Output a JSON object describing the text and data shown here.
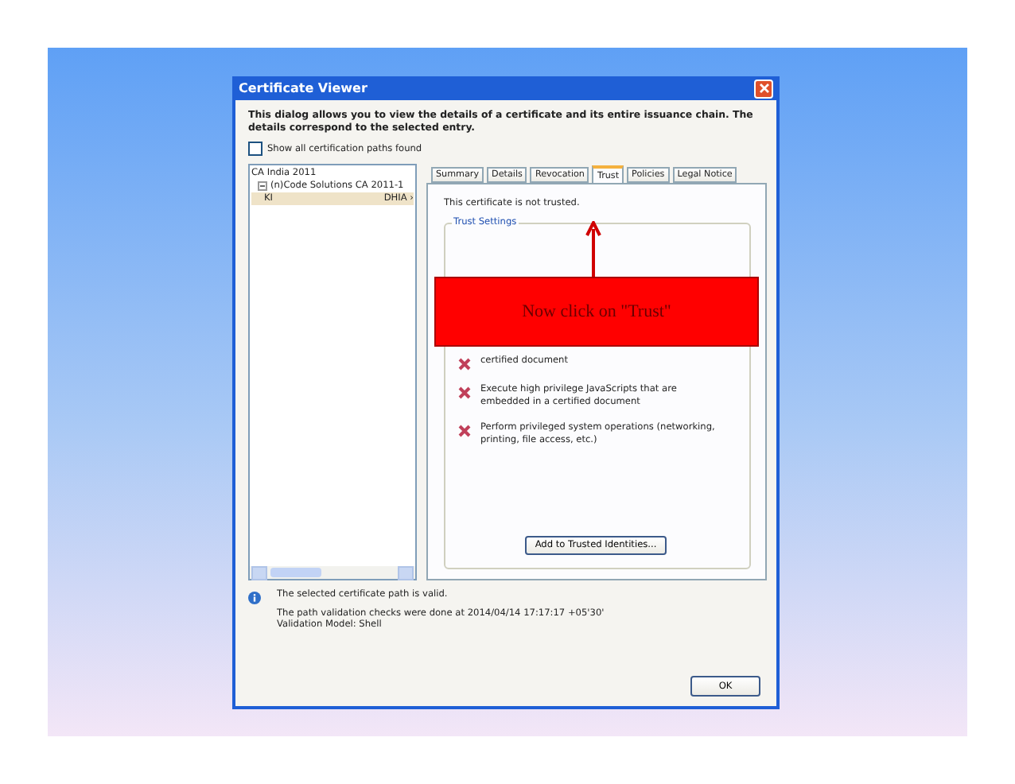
{
  "window": {
    "title": "Certificate Viewer"
  },
  "description": "This dialog allows you to view the details of a certificate and its entire issuance chain. The details correspond to the selected entry.",
  "show_all_paths": {
    "label": "Show all certification paths found",
    "checked": false
  },
  "tree": [
    {
      "label": "CA India 2011",
      "selected": false,
      "children": [
        {
          "label": "(n)Code Solutions CA 2011-1",
          "expanded": true,
          "selected": false,
          "children": [
            {
              "label": "KI",
              "column_2": "DHIA ›",
              "selected": true
            }
          ]
        }
      ]
    }
  ],
  "tabs": [
    {
      "label": "Summary",
      "selected": false
    },
    {
      "label": "Details",
      "selected": false
    },
    {
      "label": "Revocation",
      "selected": false
    },
    {
      "label": "Trust",
      "selected": true
    },
    {
      "label": "Policies",
      "selected": false
    },
    {
      "label": "Legal Notice",
      "selected": false
    }
  ],
  "trust_status": "This certificate is not trusted.",
  "trust_settings": {
    "title": "Trust Settings",
    "items": [
      {
        "kind": "denied",
        "text": "certified document"
      },
      {
        "kind": "denied",
        "text": "Execute high privilege JavaScripts that are embedded in a certified document"
      },
      {
        "kind": "denied",
        "text": "Perform privileged system operations (networking, printing, file access, etc.)"
      }
    ],
    "button": "Add to Trusted Identities..."
  },
  "status": {
    "kind": "info",
    "text": "The selected certificate path is valid."
  },
  "validation": [
    "The path validation checks were done at 2014/04/14 17:17:17 +05'30'",
    "Validation Model: Shell"
  ],
  "buttons": [
    "OK"
  ],
  "callout": {
    "text": "Now click on \"Trust\""
  }
}
